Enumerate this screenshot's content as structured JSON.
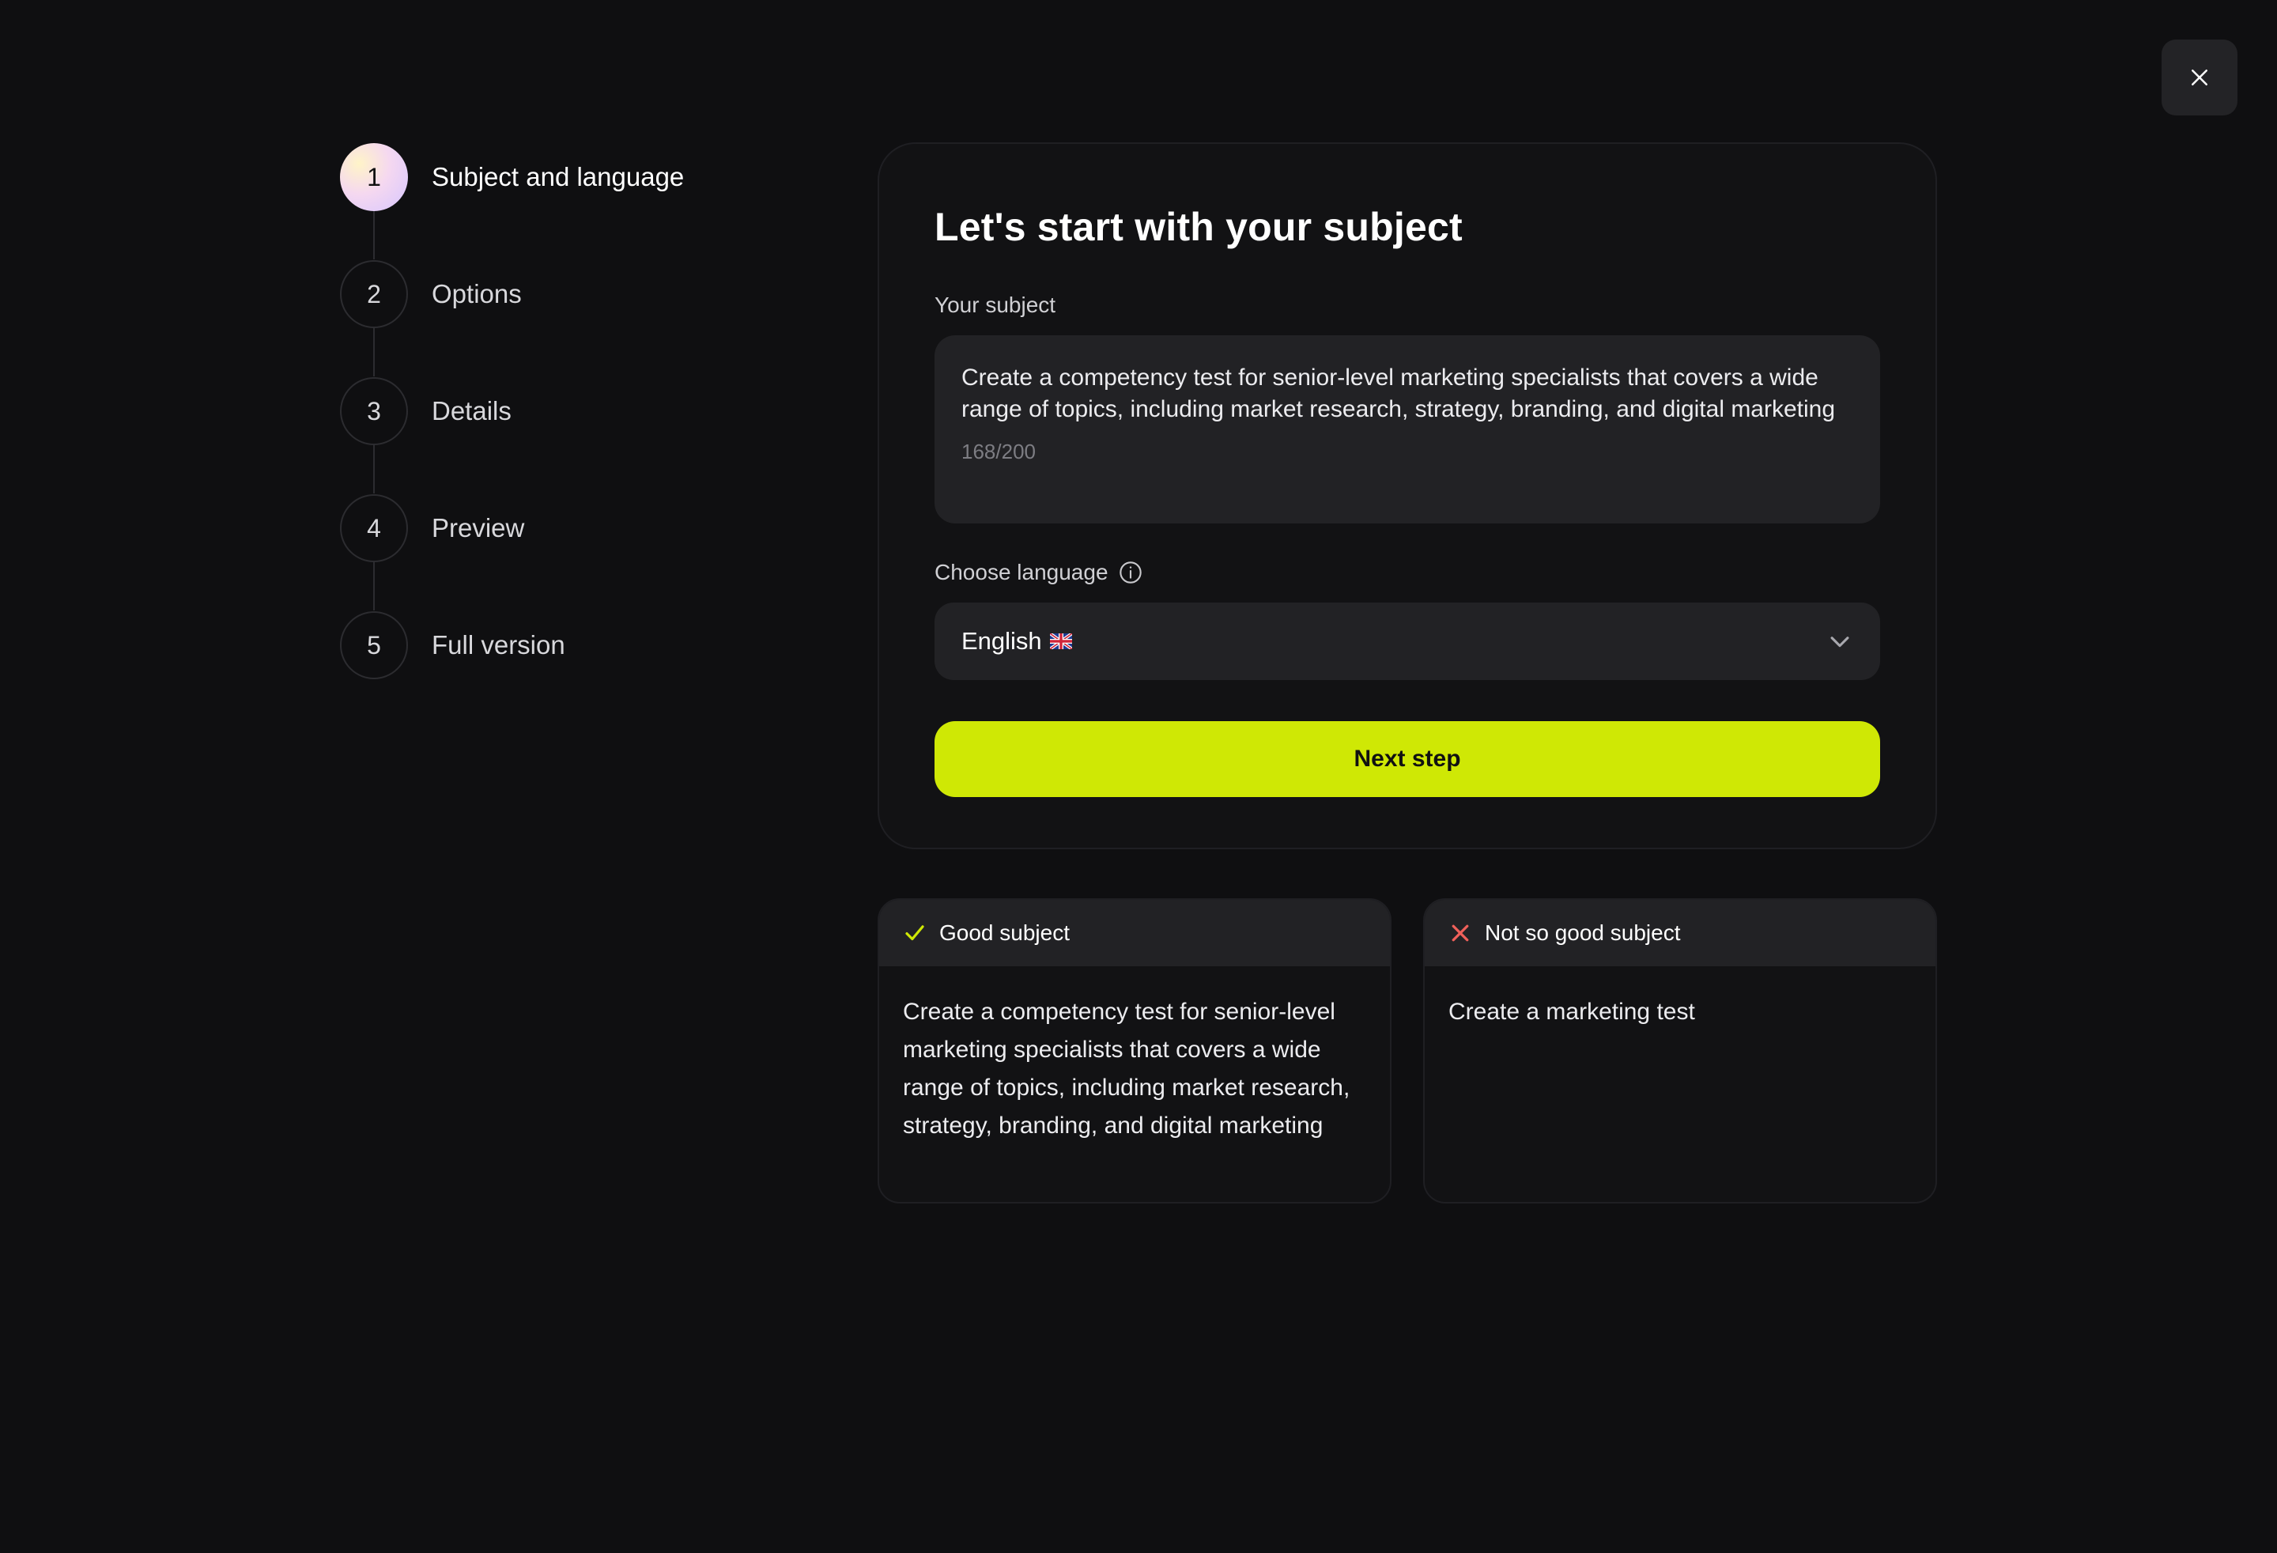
{
  "close": {
    "icon": "close-icon"
  },
  "stepper": {
    "steps": [
      {
        "number": "1",
        "label": "Subject and language",
        "active": true
      },
      {
        "number": "2",
        "label": "Options",
        "active": false
      },
      {
        "number": "3",
        "label": "Details",
        "active": false
      },
      {
        "number": "4",
        "label": "Preview",
        "active": false
      },
      {
        "number": "5",
        "label": "Full version",
        "active": false
      }
    ]
  },
  "form": {
    "title": "Let's start with your subject",
    "subject_label": "Your subject",
    "subject_value": "Create a competency test for senior-level marketing specialists that covers a wide range of topics, including market research, strategy, branding, and digital marketing",
    "char_count": "168/200",
    "language_label": "Choose language",
    "language_value": "English",
    "language_flag": "uk-flag-icon",
    "next_label": "Next step"
  },
  "examples": {
    "good": {
      "title": "Good subject",
      "text": "Create a competency test for senior-level marketing specialists that covers a wide range of topics, including market research, strategy, branding, and digital marketing"
    },
    "bad": {
      "title": "Not so good subject",
      "text": "Create a marketing test"
    }
  },
  "colors": {
    "background": "#0f0f11",
    "accent": "#cfe805",
    "good": "#cfe805",
    "bad": "#f0605a"
  }
}
